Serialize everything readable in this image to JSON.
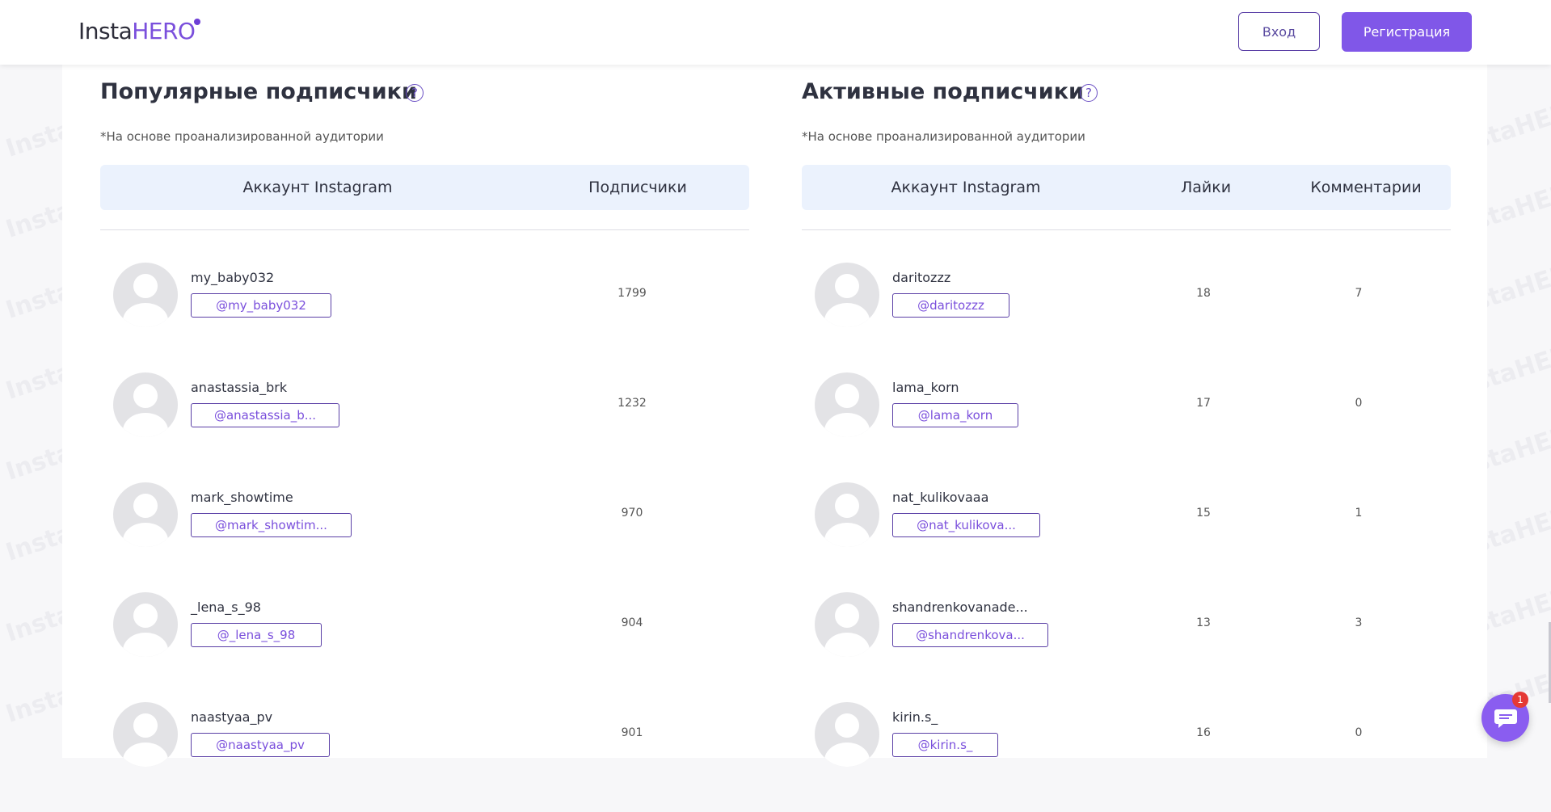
{
  "header": {
    "logo_part1": "Insta",
    "logo_part2": "HERO",
    "login_label": "Вход",
    "register_label": "Регистрация"
  },
  "watermark": "InstaHERO",
  "popular": {
    "title": "Популярные подписчики",
    "note": "*На основе проанализированной аудитории",
    "col_account": "Аккаунт Instagram",
    "col_followers": "Подписчики",
    "rows": [
      {
        "name": "my_baby032",
        "handle": "@my_baby032",
        "followers": "1799"
      },
      {
        "name": "anastassia_brk",
        "handle": "@anastassia_b...",
        "followers": "1232"
      },
      {
        "name": "mark_showtime",
        "handle": "@mark_showtim...",
        "followers": "970"
      },
      {
        "name": "_lena_s_98",
        "handle": "@_lena_s_98",
        "followers": "904"
      },
      {
        "name": "naastyaa_pv",
        "handle": "@naastyaa_pv",
        "followers": "901"
      }
    ]
  },
  "active": {
    "title": "Активные подписчики",
    "note": "*На основе проанализированной аудитории",
    "col_account": "Аккаунт Instagram",
    "col_likes": "Лайки",
    "col_comments": "Комментарии",
    "rows": [
      {
        "name": "daritozzz",
        "handle": "@daritozzz",
        "likes": "18",
        "comments": "7"
      },
      {
        "name": "lama_korn",
        "handle": "@lama_korn",
        "likes": "17",
        "comments": "0"
      },
      {
        "name": "nat_kulikovaaa",
        "handle": "@nat_kulikova...",
        "likes": "15",
        "comments": "1"
      },
      {
        "name": "shandrenkovanade...",
        "handle": "@shandrenkova...",
        "likes": "13",
        "comments": "3"
      },
      {
        "name": "kirin.s_",
        "handle": "@kirin.s_",
        "likes": "16",
        "comments": "0"
      }
    ]
  },
  "chat": {
    "badge": "1",
    "icon": "chat-bubble-icon"
  },
  "colors": {
    "accent": "#8057e8",
    "table_header": "#ebf2fd",
    "badge": "#e53935"
  }
}
